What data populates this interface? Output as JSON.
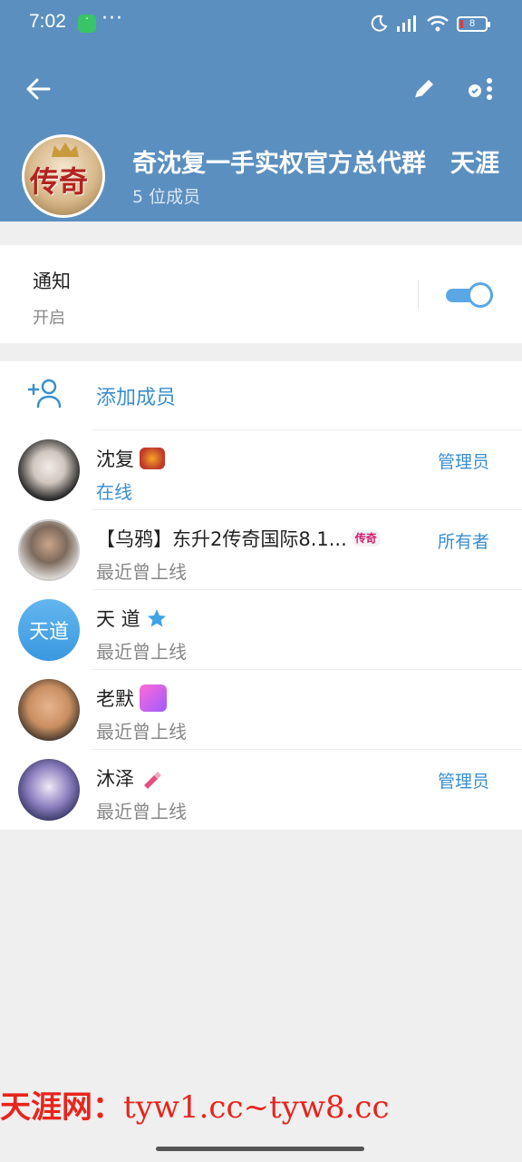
{
  "status_bar": {
    "time": "7:02",
    "more": "···",
    "battery": "8"
  },
  "group": {
    "name": "奇沈复一手实权官方总代群　天涯",
    "members": "5 位成员"
  },
  "notification": {
    "title": "通知",
    "state": "开启",
    "enabled": true
  },
  "add_member": {
    "label": "添加成员"
  },
  "members": [
    {
      "name": "沈复",
      "status": "在线",
      "online": true,
      "role": "管理员"
    },
    {
      "name": "【乌鸦】东升2传奇国际8.1...",
      "status": "最近曾上线",
      "online": false,
      "role": "所有者"
    },
    {
      "name": "天 道",
      "status": "最近曾上线",
      "online": false,
      "role": "",
      "avatar_text": "天道"
    },
    {
      "name": "老默",
      "status": "最近曾上线",
      "online": false,
      "role": ""
    },
    {
      "name": "沐泽",
      "status": "最近曾上线",
      "online": false,
      "role": "管理员"
    }
  ],
  "watermark": {
    "cn": "天涯网：",
    "url": "tyw1.cc~tyw8.cc"
  },
  "colors": {
    "header": "#5b8fbf",
    "accent": "#3a8ed0",
    "toggle": "#5aa7e6"
  }
}
